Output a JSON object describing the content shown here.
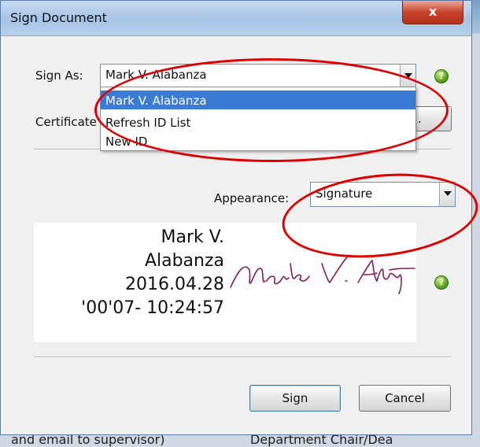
{
  "dialog": {
    "title": "Sign Document",
    "close_glyph": "x",
    "sign_as_label": "Sign As:",
    "sign_as_value": "Mark V. Alabanza",
    "certificate_label": "Certificate",
    "certificate_button_tail": ".",
    "appearance_label": "Appearance:",
    "appearance_value": "Signature",
    "help_glyph": "?",
    "dropdown_items": [
      "Mark V. Alabanza",
      "Refresh ID List",
      "New ID"
    ],
    "preview": {
      "line1": "Mark V.",
      "line2": "Alabanza",
      "line3": "2016.04.28",
      "line4": "'00'07- 10:24:57"
    },
    "sign_button": "Sign",
    "cancel_button": "Cancel"
  },
  "background": {
    "bottom_left_text": "and email to supervisor)",
    "bottom_right_text": "Department Chair/Dea"
  },
  "colors": {
    "annotation": "#e00000",
    "selection": "#3a7bd5",
    "signature_ink": "#8a1a5a"
  }
}
